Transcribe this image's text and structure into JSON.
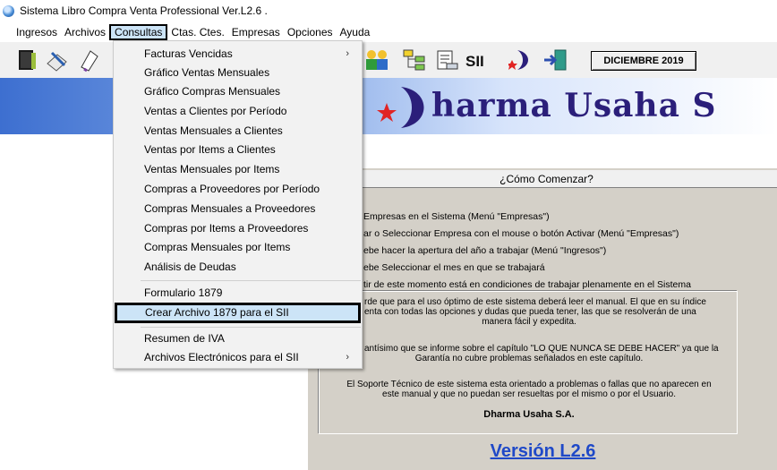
{
  "window": {
    "title": "Sistema Libro Compra Venta Professional Ver.L2.6 ."
  },
  "menubar": {
    "items": [
      "Ingresos",
      "Archivos",
      "Consultas",
      "Ctas. Ctes.",
      "Empresas",
      "Opciones",
      "Ayuda"
    ],
    "active": "Consultas"
  },
  "toolbar": {
    "period": "DICIEMBRE 2019"
  },
  "banner": {
    "text": "harma Usaha S"
  },
  "dropdown": {
    "items": [
      {
        "label": "Facturas Vencidas",
        "submenu": true
      },
      {
        "label": "Gráfico Ventas Mensuales"
      },
      {
        "label": "Gráfico Compras Mensuales"
      },
      {
        "label": "Ventas a Clientes por Período"
      },
      {
        "label": "Ventas Mensuales a Clientes"
      },
      {
        "label": "Ventas por Items a Clientes"
      },
      {
        "label": "Ventas Mensuales por Items"
      },
      {
        "label": "Compras a Proveedores por Período"
      },
      {
        "label": "Compras Mensuales a Proveedores"
      },
      {
        "label": "Compras por Items a Proveedores"
      },
      {
        "label": "Compras Mensuales por Items"
      },
      {
        "label": "Análisis de Deudas"
      },
      {
        "label": "Formulario 1879"
      },
      {
        "label": "Crear Archivo 1879 para el SII",
        "highlighted": true
      },
      {
        "label": "Resumen de IVA"
      },
      {
        "label": "Archivos Electrónicos para el SII",
        "submenu": true
      }
    ]
  },
  "panel": {
    "header": "¿Cómo Comenzar?",
    "steps": [
      "Empresas en el Sistema (Menú \"Empresas\")",
      "ar o Seleccionar Empresa con el mouse o botón Activar (Menú \"Empresas\")",
      "ebe hacer la apertura del año a trabajar (Menú \"Ingresos\")",
      "ebe Seleccionar el mes en que se trabajará",
      "tir de este momento está en condiciones de trabajar plenamente en el Sistema"
    ],
    "info1": "rde que para el uso óptimo de este sistema deberá leer el manual. El que en su índice",
    "info1b": "enta con todas las opciones y dudas que pueda tener, las que se resolverán de una",
    "info1c": "manera fácil y expedita.",
    "info2": "antísimo que se informe sobre el capítulo \"LO QUE NUNCA SE DEBE HACER\" ya que la",
    "info2b": "Garantía no cubre problemas señalados en este capítulo.",
    "info3": "El Soporte Técnico de este sistema esta orientado a problemas o fallas que no aparecen en",
    "info3b": "este manual y que no puedan ser resueltas por el mismo o por el Usuario.",
    "company": "Dharma Usaha S.A.",
    "version": "Versión L2.6"
  }
}
